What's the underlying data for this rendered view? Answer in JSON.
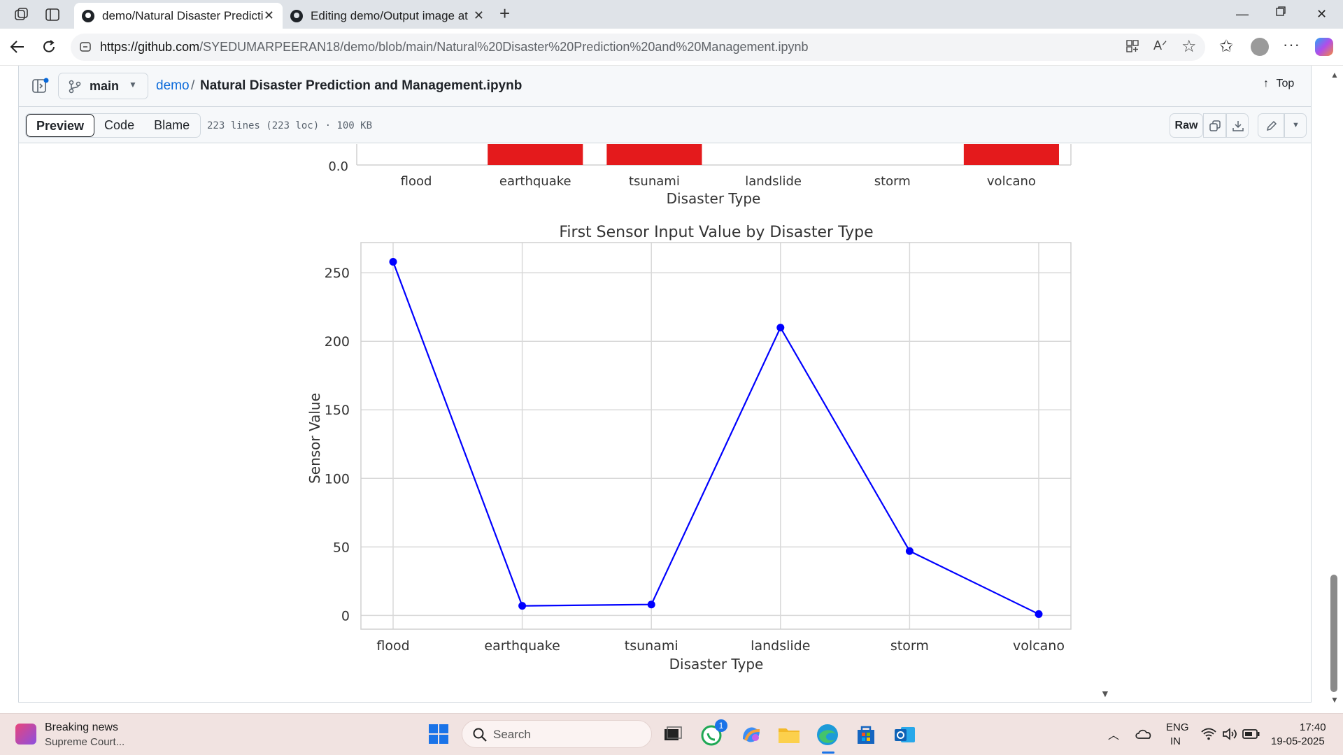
{
  "browser": {
    "tabs": [
      {
        "title": "demo/Natural Disaster Prediction",
        "active": true
      },
      {
        "title": "Editing demo/Output image at m",
        "active": false
      }
    ],
    "url_host": "https://github.com",
    "url_path": "/SYEDUMARPEERAN18/demo/blob/main/Natural%20Disaster%20Prediction%20and%20Management.ipynb"
  },
  "github": {
    "branch": "main",
    "repo": "demo",
    "separator": "/",
    "filename": "Natural Disaster Prediction and Management.ipynb",
    "top_label": "Top",
    "view_tabs": [
      "Preview",
      "Code",
      "Blame"
    ],
    "file_info": "223 lines (223 loc) · 100 KB",
    "raw_label": "Raw"
  },
  "colors": {
    "bar": "#e41a1c",
    "line": "#0000ff",
    "grid": "#d9d9d9",
    "link": "#0969da"
  },
  "chart_data": [
    {
      "type": "bar",
      "categories": [
        "flood",
        "earthquake",
        "tsunami",
        "landslide",
        "storm",
        "volcano"
      ],
      "visible_bars": [
        false,
        true,
        true,
        false,
        false,
        true
      ],
      "ytick_visible": "0.0",
      "xlabel": "Disaster Type"
    },
    {
      "type": "line",
      "title": "First Sensor Input Value by Disaster Type",
      "categories": [
        "flood",
        "earthquake",
        "tsunami",
        "landslide",
        "storm",
        "volcano"
      ],
      "values": [
        258,
        7,
        8,
        210,
        47,
        1
      ],
      "xlabel": "Disaster Type",
      "ylabel": "Sensor Value",
      "ylim": [
        -10,
        272
      ],
      "yticks": [
        "0",
        "50",
        "100",
        "150",
        "200",
        "250"
      ],
      "grid": true,
      "marker": "circle"
    }
  ],
  "taskbar": {
    "news_title": "Breaking news",
    "news_subtitle": "Supreme Court...",
    "search_placeholder": "Search",
    "whatsapp_badge": "1",
    "lang_line1": "ENG",
    "lang_line2": "IN",
    "time": "17:40",
    "date": "19-05-2025"
  }
}
